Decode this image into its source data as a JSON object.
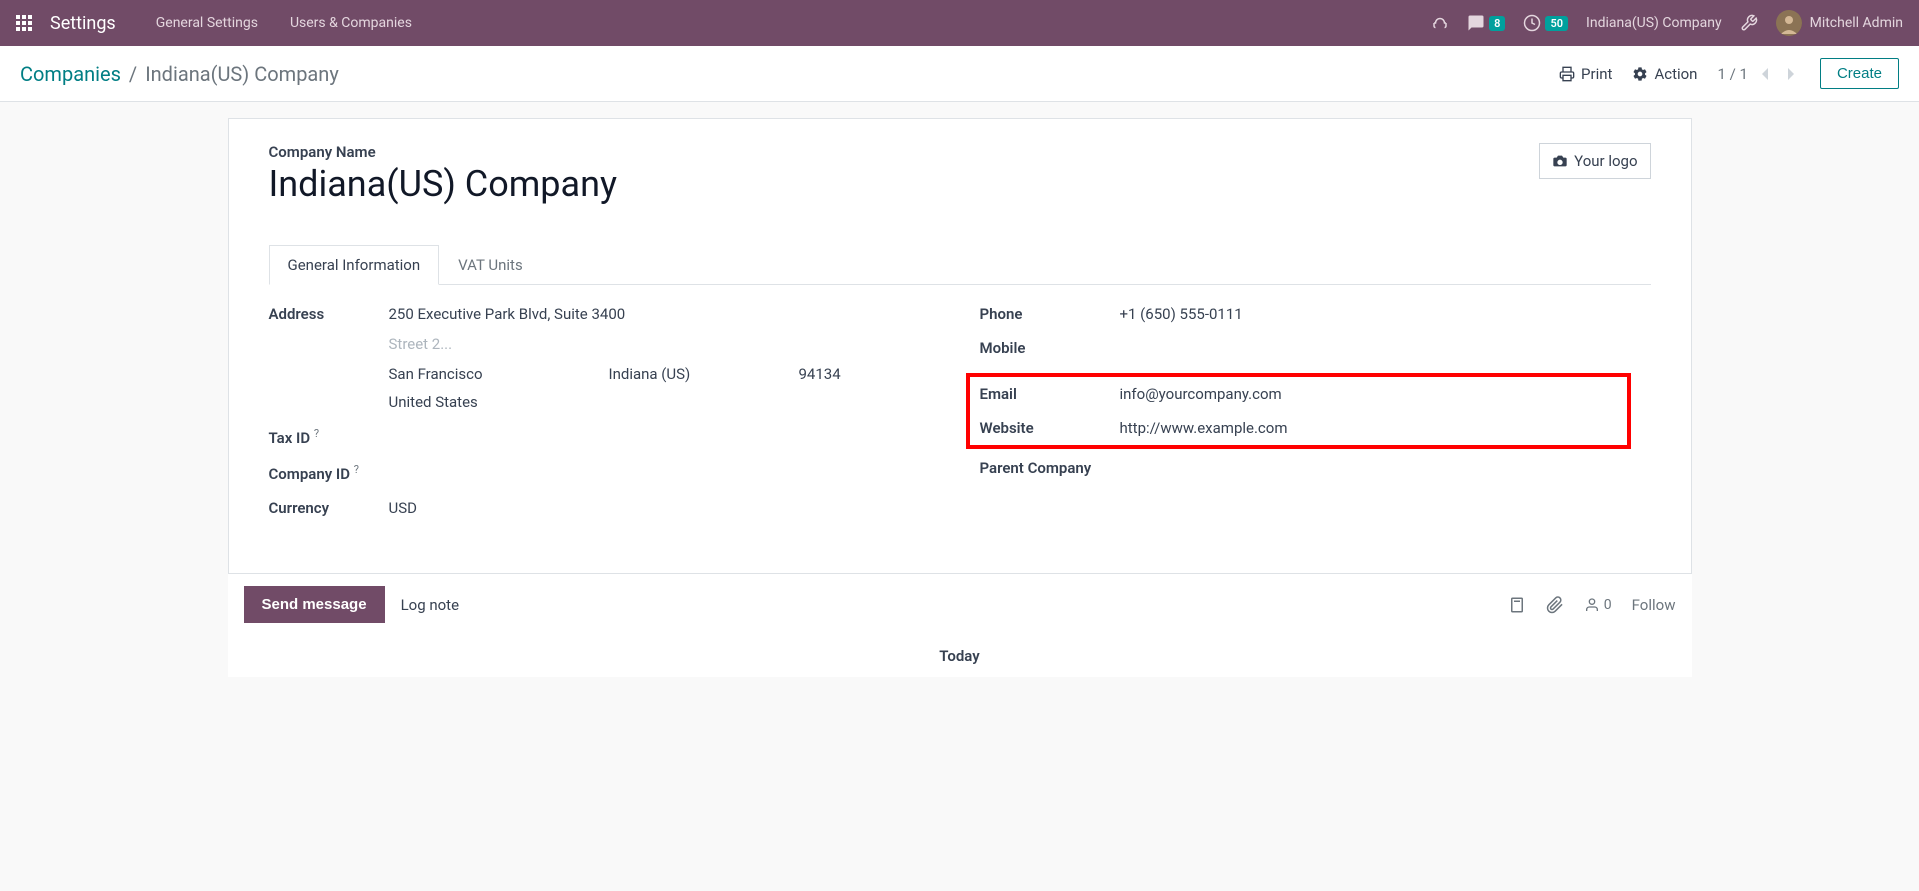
{
  "topbar": {
    "title": "Settings",
    "nav": {
      "general": "General Settings",
      "users": "Users & Companies"
    },
    "messages_badge": "8",
    "activities_badge": "50",
    "company_selector": "Indiana(US) Company",
    "username": "Mitchell Admin"
  },
  "controlbar": {
    "breadcrumb_root": "Companies",
    "breadcrumb_current": "Indiana(US) Company",
    "print_label": "Print",
    "action_label": "Action",
    "pager": "1 / 1",
    "create_label": "Create"
  },
  "form": {
    "company_name_label": "Company Name",
    "company_name": "Indiana(US) Company",
    "logo_btn": "Your logo",
    "tabs": {
      "general": "General Information",
      "vat": "VAT Units"
    },
    "left": {
      "address_label": "Address",
      "street": "250 Executive Park Blvd, Suite 3400",
      "street2_placeholder": "Street 2...",
      "city": "San Francisco",
      "state": "Indiana (US)",
      "zip": "94134",
      "country": "United States",
      "tax_id_label": "Tax ID",
      "company_id_label": "Company ID",
      "currency_label": "Currency",
      "currency": "USD"
    },
    "right": {
      "phone_label": "Phone",
      "phone": "+1 (650) 555-0111",
      "mobile_label": "Mobile",
      "email_label": "Email",
      "email": "info@yourcompany.com",
      "website_label": "Website",
      "website": "http://www.example.com",
      "parent_label": "Parent Company"
    }
  },
  "chatter": {
    "send_message": "Send message",
    "log_note": "Log note",
    "follower_count": "0",
    "follow": "Follow",
    "today": "Today"
  }
}
